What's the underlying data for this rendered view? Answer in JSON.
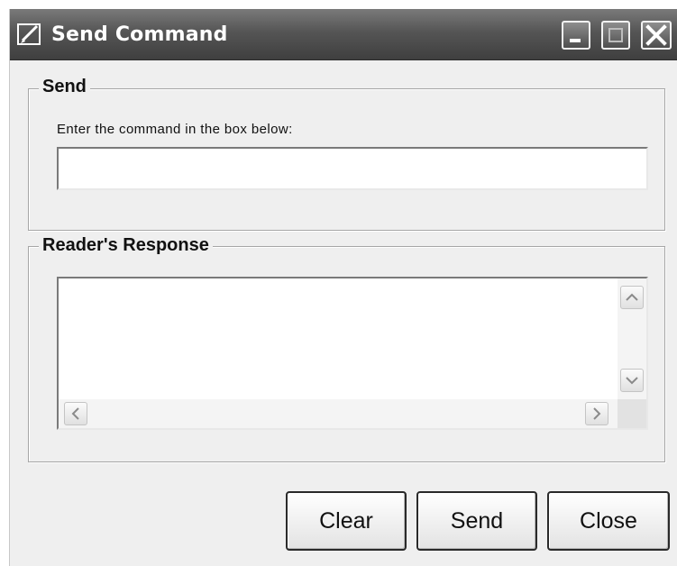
{
  "window": {
    "title": "Send Command",
    "icon": "edit-pencil-icon"
  },
  "titlebar_buttons": {
    "minimize_icon": "minimize-icon",
    "maximize_icon": "maximize-icon",
    "close_icon": "close-icon"
  },
  "send_group": {
    "legend": "Send",
    "prompt": "Enter the command in the box below:",
    "command_value": "",
    "command_placeholder": ""
  },
  "response_group": {
    "legend": "Reader's Response",
    "content": ""
  },
  "buttons": {
    "clear": "Clear",
    "send": "Send",
    "close": "Close"
  },
  "colors": {
    "titlebar": "#555555",
    "window_bg": "#efefef",
    "title_text": "#ffffff"
  }
}
